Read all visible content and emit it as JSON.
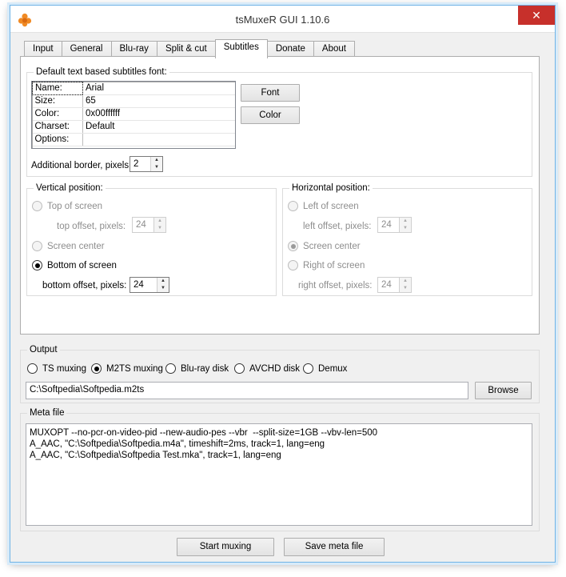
{
  "window": {
    "title": "tsMuxeR GUI 1.10.6",
    "close_symbol": "✕"
  },
  "tabs": [
    {
      "label": "Input"
    },
    {
      "label": "General"
    },
    {
      "label": "Blu-ray"
    },
    {
      "label": "Split & cut"
    },
    {
      "label": "Subtitles"
    },
    {
      "label": "Donate"
    },
    {
      "label": "About"
    }
  ],
  "active_tab": "Subtitles",
  "font_group": {
    "label": "Default text based subtitles font:",
    "rows": [
      {
        "key": "Name:",
        "value": "Arial"
      },
      {
        "key": "Size:",
        "value": "65"
      },
      {
        "key": "Color:",
        "value": "0x00ffffff"
      },
      {
        "key": "Charset:",
        "value": "Default"
      },
      {
        "key": "Options:",
        "value": ""
      }
    ],
    "font_button": "Font",
    "color_button": "Color",
    "border_label": "Additional border, pixels:",
    "border_value": "2"
  },
  "vertical": {
    "label": "Vertical position:",
    "top_label": "Top of screen",
    "top_offset_label": "top offset, pixels:",
    "top_offset_value": "24",
    "center_label": "Screen center",
    "bottom_label": "Bottom of screen",
    "bottom_offset_label": "bottom offset, pixels:",
    "bottom_offset_value": "24",
    "selected": "bottom"
  },
  "horizontal": {
    "label": "Horizontal position:",
    "left_label": "Left of screen",
    "left_offset_label": "left offset, pixels:",
    "left_offset_value": "24",
    "center_label": "Screen center",
    "right_label": "Right of screen",
    "right_offset_label": "right offset, pixels:",
    "right_offset_value": "24",
    "selected": "center"
  },
  "output": {
    "label": "Output",
    "options": [
      {
        "label": "TS muxing"
      },
      {
        "label": "M2TS muxing"
      },
      {
        "label": "Blu-ray disk"
      },
      {
        "label": "AVCHD disk"
      },
      {
        "label": "Demux"
      }
    ],
    "selected": "M2TS muxing",
    "path": "C:\\Softpedia\\Softpedia.m2ts",
    "browse_button": "Browse"
  },
  "meta": {
    "label": "Meta file",
    "lines": [
      "MUXOPT --no-pcr-on-video-pid --new-audio-pes --vbr  --split-size=1GB --vbv-len=500",
      "A_AAC, \"C:\\Softpedia\\Softpedia.m4a\", timeshift=2ms, track=1, lang=eng",
      "A_AAC, \"C:\\Softpedia\\Softpedia Test.mka\", track=1, lang=eng"
    ]
  },
  "actions": {
    "start_button": "Start muxing",
    "save_button": "Save meta file"
  },
  "colors": {
    "close": "#c7302b",
    "window_border": "#6fb3e6",
    "face": "#f0f0f0"
  }
}
